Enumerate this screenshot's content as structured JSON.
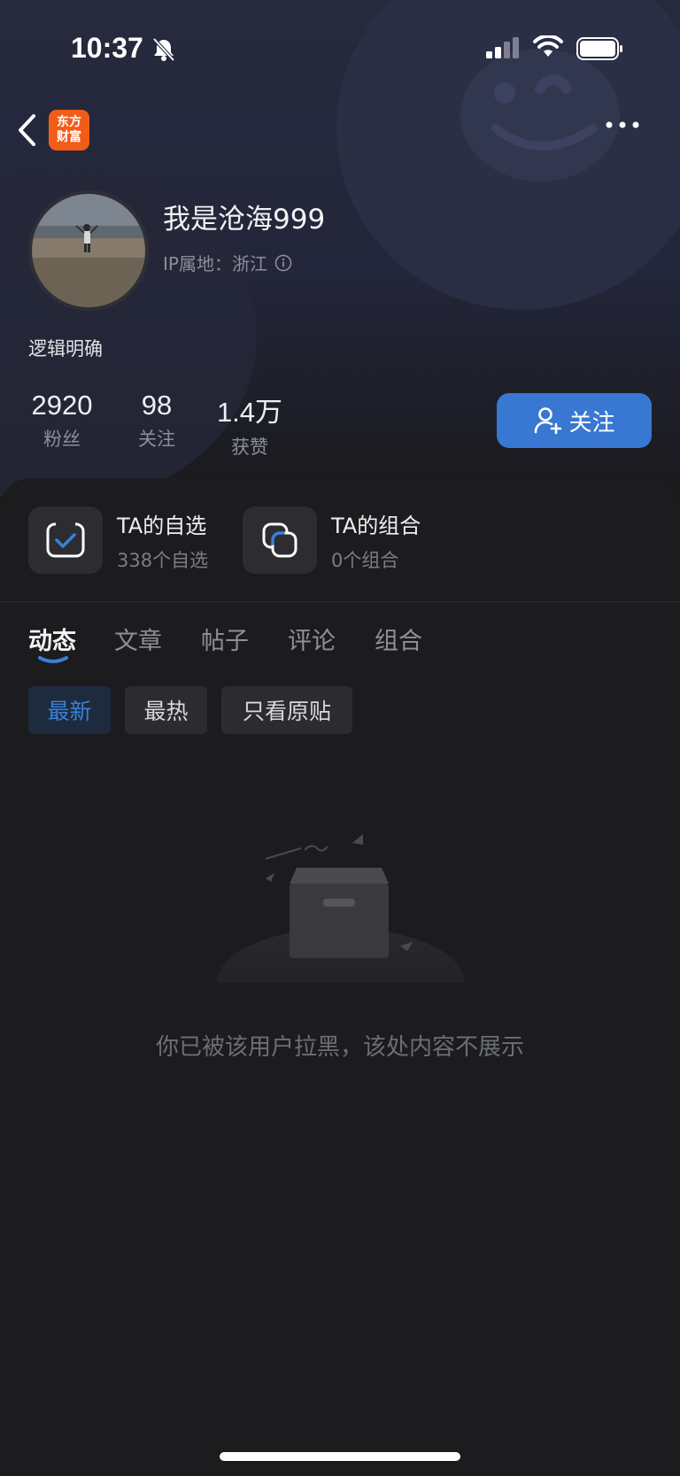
{
  "status_bar": {
    "time": "10:37",
    "icons": [
      "bell-off-icon",
      "cellular-signal-icon",
      "wifi-icon",
      "battery-icon"
    ]
  },
  "nav": {
    "logo_line1": "东方",
    "logo_line2": "财富",
    "icons": [
      "back-arrow-icon",
      "more-dots-icon"
    ],
    "logo_color": "#f25c19"
  },
  "profile": {
    "username": "我是沧海999",
    "ip_label": "IP属地：浙江",
    "bio": "逻辑明确",
    "stats": [
      {
        "value": "2920",
        "label": "粉丝"
      },
      {
        "value": "98",
        "label": "关注"
      },
      {
        "value": "1.4万",
        "label": "获赞"
      }
    ],
    "follow_label": "关注",
    "follow_color": "#3878d2"
  },
  "quick_links": [
    {
      "title": "TA的自选",
      "subtitle": "338个自选",
      "icon": "watchlist-check-icon"
    },
    {
      "title": "TA的组合",
      "subtitle": "0个组合",
      "icon": "portfolio-squares-icon"
    }
  ],
  "tabs": [
    {
      "label": "动态",
      "active": true
    },
    {
      "label": "文章",
      "active": false
    },
    {
      "label": "帖子",
      "active": false
    },
    {
      "label": "评论",
      "active": false
    },
    {
      "label": "组合",
      "active": false
    }
  ],
  "filters": [
    {
      "label": "最新",
      "active": true
    },
    {
      "label": "最热",
      "active": false
    },
    {
      "label": "只看原贴",
      "active": false
    }
  ],
  "empty_state": {
    "message": "你已被该用户拉黑，该处内容不展示",
    "icon": "empty-box-icon"
  },
  "accent_color": "#3a80d8"
}
